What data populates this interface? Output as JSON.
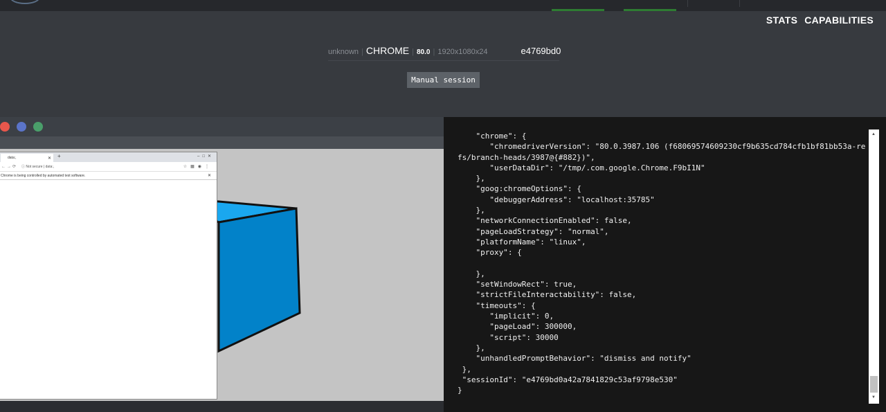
{
  "header": {
    "tabs": [
      {
        "label": "STATS"
      },
      {
        "label": "CAPABILITIES"
      }
    ],
    "session_info": {
      "platform": "unknown",
      "browser_name": "CHROME",
      "browser_version": "80.0",
      "resolution": "1920x1080x24",
      "session_id_short": "e4769bd0"
    },
    "manual_session_label": "Manual session"
  },
  "vnc": {
    "window_dots": [
      "#e8574c",
      "#5b74c9",
      "#4a9e6a"
    ],
    "browser_window": {
      "tab_title": "data:,",
      "address_warning": "Not secure",
      "address_url": "data:,",
      "automation_notice": "Chrome is being controlled by automated test software."
    },
    "cube_colors": {
      "front": "#0282c9",
      "top": "#1aa7ef"
    }
  },
  "capabilities": {
    "json_text": "    \"chrome\": {\n       \"chromedriverVersion\": \"80.0.3987.106 (f68069574609230cf9b635cd784cfb1bf81bb53a-refs/branch-heads/3987@{#882})\",\n       \"userDataDir\": \"/tmp/.com.google.Chrome.F9bI1N\"\n    },\n    \"goog:chromeOptions\": {\n       \"debuggerAddress\": \"localhost:35785\"\n    },\n    \"networkConnectionEnabled\": false,\n    \"pageLoadStrategy\": \"normal\",\n    \"platformName\": \"linux\",\n    \"proxy\": {\n\n    },\n    \"setWindowRect\": true,\n    \"strictFileInteractability\": false,\n    \"timeouts\": {\n       \"implicit\": 0,\n       \"pageLoad\": 300000,\n       \"script\": 30000\n    },\n    \"unhandledPromptBehavior\": \"dismiss and notify\"\n },\n \"sessionId\": \"e4769bd0a42a7841829c53af9798e530\"\n}"
  }
}
